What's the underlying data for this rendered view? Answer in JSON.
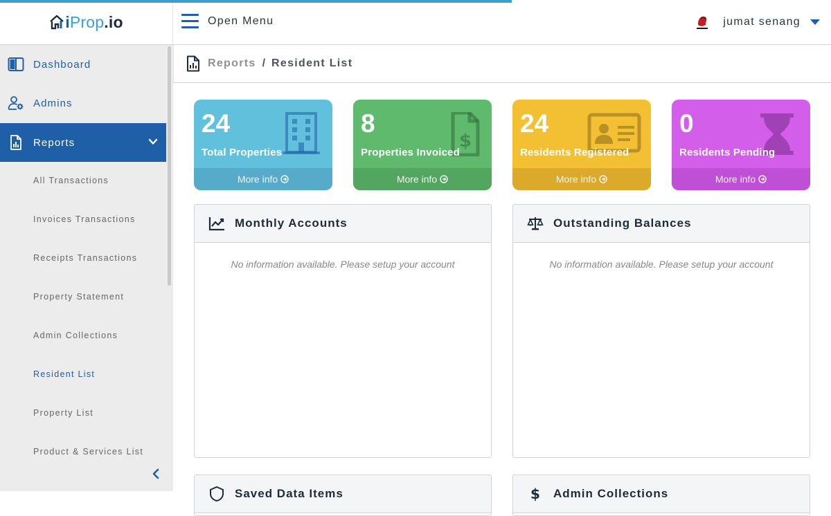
{
  "app": {
    "logo_part1": "Prop",
    "logo_part2": ".io",
    "logo_prefix": "i",
    "menu_label": "Open Menu",
    "user_name": "jumat senang"
  },
  "sidebar": {
    "items": [
      {
        "label": "Dashboard",
        "icon": "columns-icon"
      },
      {
        "label": "Admins",
        "icon": "user-cog-icon"
      },
      {
        "label": "Reports",
        "icon": "report-file-icon",
        "expanded": true
      }
    ],
    "subitems": [
      "All Transactions",
      "Invoices Transactions",
      "Receipts Transactions",
      "Property Statement",
      "Admin Collections",
      "Resident List",
      "Property List",
      "Product & Services List"
    ],
    "selected": "Resident List"
  },
  "breadcrumb": {
    "parent": "Reports",
    "separator": "/",
    "current": "Resident List"
  },
  "stats": [
    {
      "value": "24",
      "label": "Total Properties",
      "more": "More info",
      "icon": "building-icon",
      "color": "#61c0dc"
    },
    {
      "value": "8",
      "label": "Properties Invoiced",
      "more": "More info",
      "icon": "invoice-dollar-icon",
      "color": "#5fba6e"
    },
    {
      "value": "24",
      "label": "Residents Registered",
      "more": "More info",
      "icon": "id-card-icon",
      "color": "#f4c033"
    },
    {
      "value": "0",
      "label": "Residents Pending",
      "more": "More info",
      "icon": "hourglass-icon",
      "color": "#d35ee9"
    }
  ],
  "panels": [
    {
      "title": "Monthly Accounts",
      "icon": "line-chart-icon",
      "empty_text": "No information available. Please setup your account"
    },
    {
      "title": "Outstanding Balances",
      "icon": "balance-scale-icon",
      "empty_text": "No information available. Please setup your account"
    },
    {
      "title": "Saved Data Items",
      "icon": "shield-icon"
    },
    {
      "title": "Admin Collections",
      "icon": "dollar-icon"
    }
  ],
  "colors": {
    "primary": "#1f5fa8",
    "accent": "#3aa0d4",
    "sidebar_bg": "#ececec"
  }
}
